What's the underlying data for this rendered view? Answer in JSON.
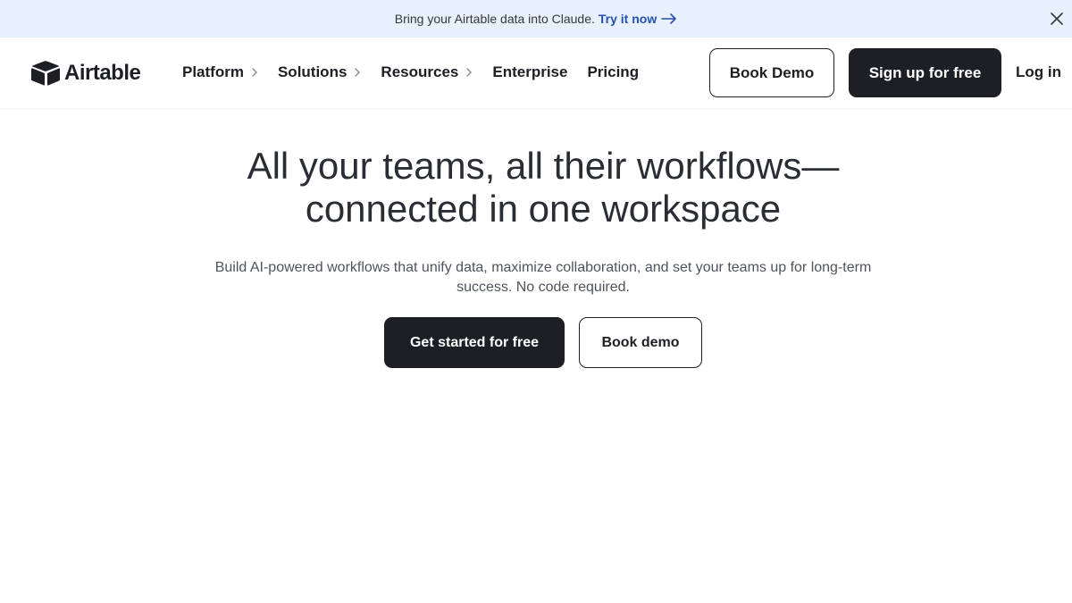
{
  "banner": {
    "message": "Bring your Airtable data into Claude.",
    "link_label": "Try it now",
    "link_icon": "arrow-right-icon",
    "close_icon": "close-icon"
  },
  "header": {
    "logo_text": "Airtable",
    "nav": [
      {
        "label": "Platform",
        "has_submenu": true
      },
      {
        "label": "Solutions",
        "has_submenu": true
      },
      {
        "label": "Resources",
        "has_submenu": true
      },
      {
        "label": "Enterprise",
        "has_submenu": false
      },
      {
        "label": "Pricing",
        "has_submenu": false
      }
    ],
    "book_demo_label": "Book Demo",
    "signup_label": "Sign up for free",
    "login_label": "Log in"
  },
  "hero": {
    "title_line1": "All your teams, all their workflows—",
    "title_line2": "connected in one workspace",
    "subtitle": "Build AI-powered workflows that unify data, maximize collaboration, and set your teams up for long-term success. No code required.",
    "primary_cta": "Get started for free",
    "secondary_cta": "Book demo"
  },
  "colors": {
    "banner_bg": "#e8f0fb",
    "link_blue": "#2450b2",
    "dark": "#1d1f25"
  }
}
